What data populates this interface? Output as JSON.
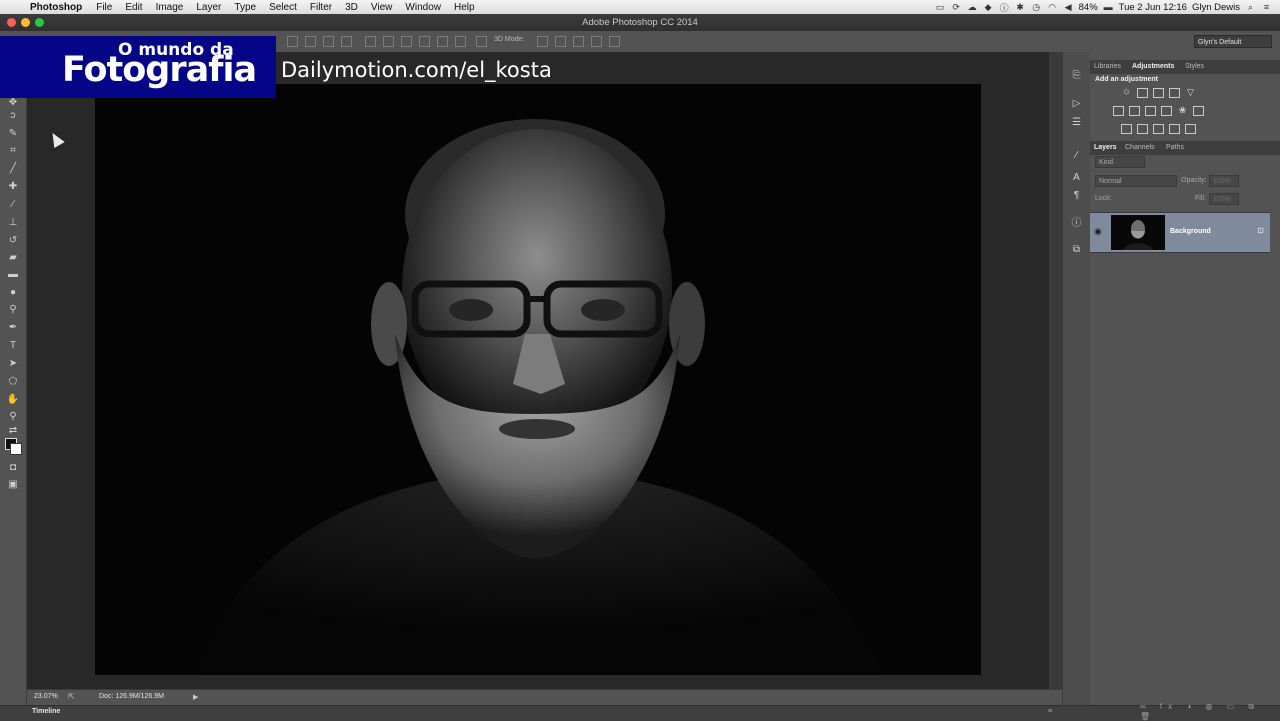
{
  "menubar": {
    "app_name": "Photoshop",
    "items": [
      "File",
      "Edit",
      "Image",
      "Layer",
      "Type",
      "Select",
      "Filter",
      "3D",
      "View",
      "Window",
      "Help"
    ],
    "battery": "84%",
    "clock": "Tue 2 Jun  12:16",
    "user": "Glyn Dewis"
  },
  "window": {
    "title": "Adobe Photoshop CC 2014"
  },
  "options_bar": {
    "mode_label": "3D Mode:",
    "workspace": "Glyn's Default"
  },
  "overlay": {
    "logo_line1": "O mundo da",
    "logo_line2": "Fotografia",
    "watermark": "Dailymotion.com/el_kosta"
  },
  "panels": {
    "top_tabs": [
      "Libraries",
      "Adjustments",
      "Styles"
    ],
    "adjustments_title": "Add an adjustment",
    "layer_tabs": [
      "Layers",
      "Channels",
      "Paths"
    ],
    "filter_kind": "Kind",
    "blend_mode": "Normal",
    "opacity_label": "Opacity:",
    "opacity_value": "100%",
    "lock_label": "Lock:",
    "fill_label": "Fill:",
    "fill_value": "100%",
    "layers": [
      {
        "name": "Background",
        "visible": true,
        "locked": true
      }
    ]
  },
  "status": {
    "zoom": "23.07%",
    "doc": "Doc: 126.9M/126.9M"
  },
  "timeline": {
    "label": "Timeline"
  },
  "colors": {
    "panel_bg": "#535353",
    "pasteboard": "#282828",
    "layer_selected": "#7f8a9c",
    "logo_bg": "#050588"
  }
}
